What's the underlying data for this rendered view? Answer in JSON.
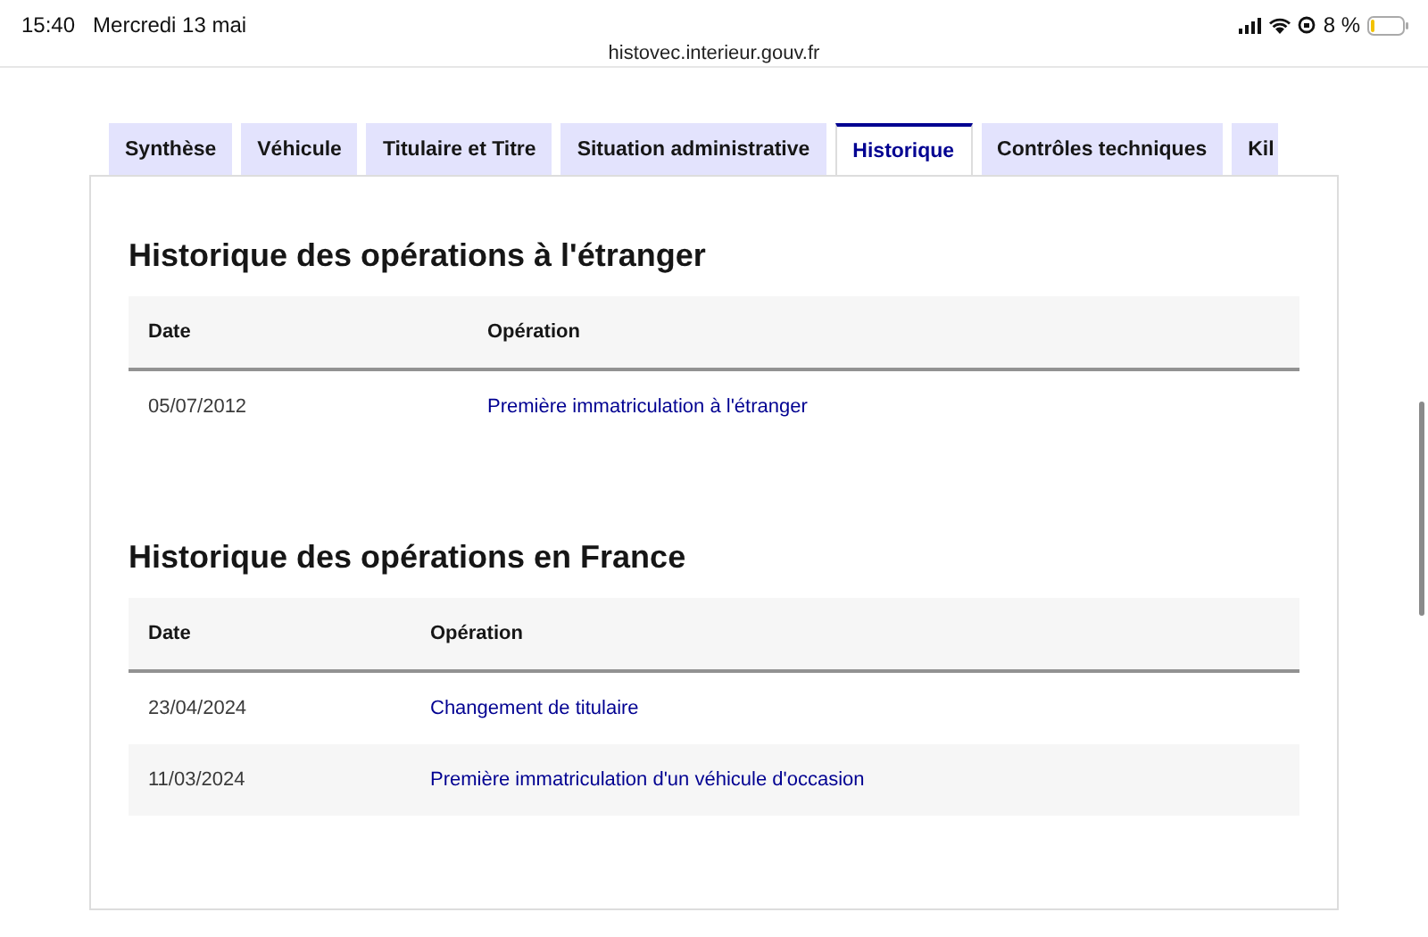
{
  "status_bar": {
    "time": "15:40",
    "date": "Mercredi 13 mai",
    "battery": "8 %"
  },
  "address_bar": {
    "url": "histovec.interieur.gouv.fr"
  },
  "tabs": [
    {
      "label": "Synthèse",
      "selected": false
    },
    {
      "label": "Véhicule",
      "selected": false
    },
    {
      "label": "Titulaire et Titre",
      "selected": false
    },
    {
      "label": "Situation administrative",
      "selected": false
    },
    {
      "label": "Historique",
      "selected": true
    },
    {
      "label": "Contrôles techniques",
      "selected": false
    },
    {
      "label": "Kil",
      "selected": false
    }
  ],
  "sections": [
    {
      "title": "Historique des opérations à l'étranger",
      "columns": [
        "Date",
        "Opération"
      ],
      "rows": [
        {
          "date": "05/07/2012",
          "operation": "Première immatriculation à l'étranger"
        }
      ]
    },
    {
      "title": "Historique des opérations en France",
      "columns": [
        "Date",
        "Opération"
      ],
      "rows": [
        {
          "date": "23/04/2024",
          "operation": "Changement de titulaire"
        },
        {
          "date": "11/03/2024",
          "operation": "Première immatriculation d'un véhicule d'occasion"
        }
      ]
    }
  ]
}
